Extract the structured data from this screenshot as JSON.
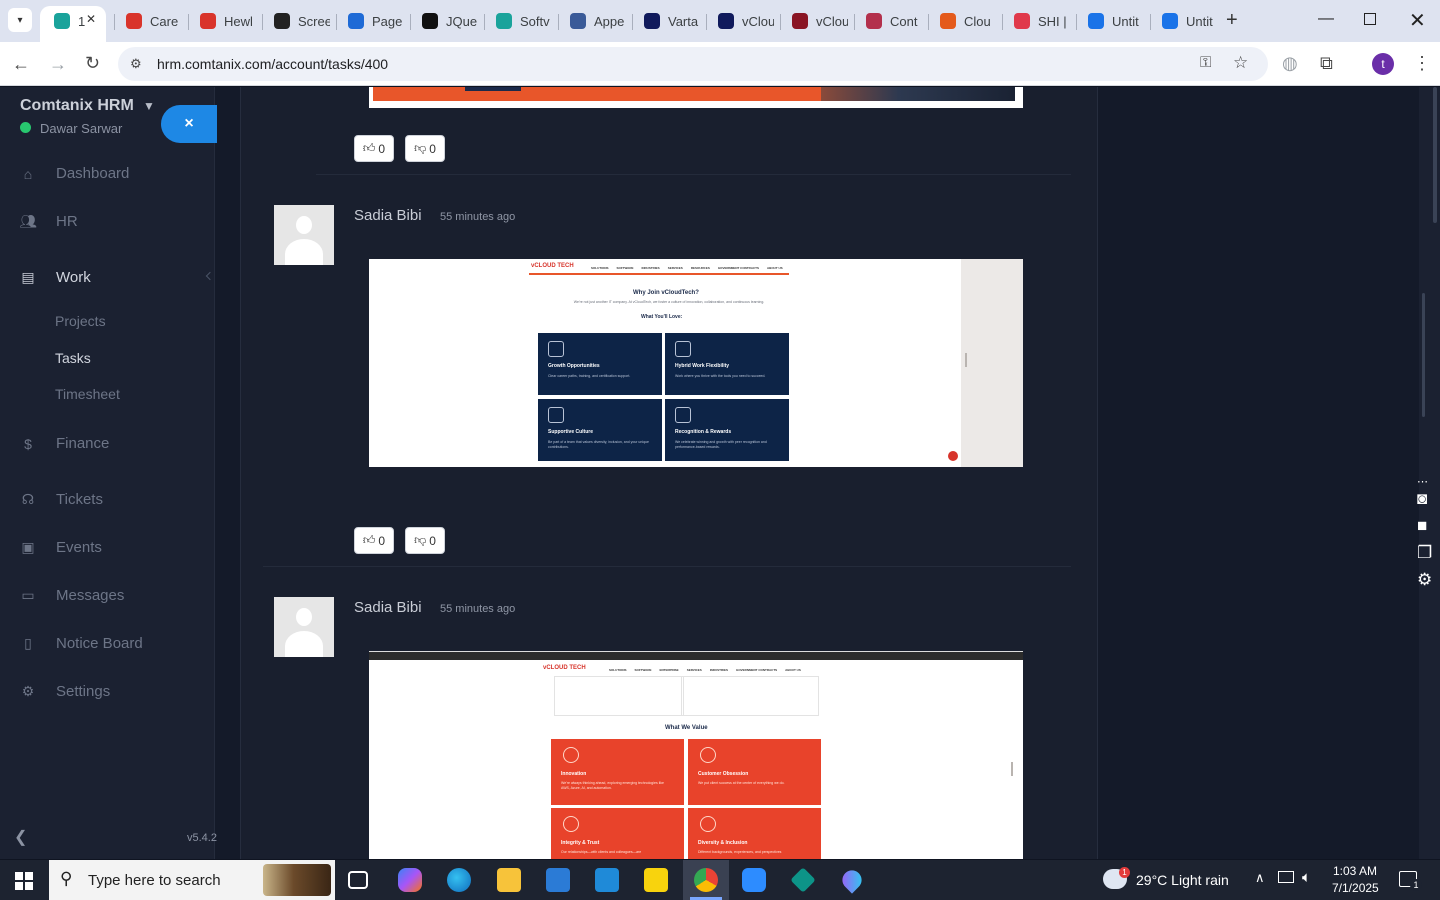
{
  "browser": {
    "tabs": [
      {
        "label": "1",
        "icon": "tab-favicon-icon",
        "color": "#1aa39b"
      },
      {
        "label": "Care",
        "icon": "tab-favicon-icon",
        "color": "#d9342b"
      },
      {
        "label": "Hewl",
        "icon": "tab-favicon-icon",
        "color": "#d9342b"
      },
      {
        "label": "Scree",
        "icon": "tab-favicon-icon",
        "color": "#222222"
      },
      {
        "label": "Page",
        "icon": "tab-favicon-icon",
        "color": "#1e6ad6"
      },
      {
        "label": "JQue",
        "icon": "tab-favicon-icon",
        "color": "#111111"
      },
      {
        "label": "Softv",
        "icon": "tab-favicon-icon",
        "color": "#1aa39b"
      },
      {
        "label": "Appe",
        "icon": "tab-favicon-icon",
        "color": "#3a5a98"
      },
      {
        "label": "Varta",
        "icon": "tab-favicon-icon",
        "color": "#101a5c"
      },
      {
        "label": "vClou",
        "icon": "tab-favicon-icon",
        "color": "#101a5c"
      },
      {
        "label": "vClou",
        "icon": "tab-favicon-icon",
        "color": "#8a1524"
      },
      {
        "label": "Cont",
        "icon": "tab-favicon-icon",
        "color": "#b3304c"
      },
      {
        "label": "Clou",
        "icon": "tab-favicon-icon",
        "color": "#e45a1b"
      },
      {
        "label": "SHI |",
        "icon": "tab-favicon-icon",
        "color": "#e0394b"
      },
      {
        "label": "Untit",
        "icon": "doc-icon",
        "color": "#1a73e8"
      },
      {
        "label": "Untit",
        "icon": "doc-icon",
        "color": "#1a73e8"
      }
    ],
    "url": "hrm.comtanix.com/account/tasks/400",
    "profile_initial": "t"
  },
  "sidebar": {
    "brand": "Comtanix HRM",
    "user": "Dawar Sarwar",
    "close_symbol": "×",
    "nav": [
      {
        "label": "Dashboard",
        "icon": "home-icon"
      },
      {
        "label": "HR",
        "icon": "users-icon"
      },
      {
        "label": "Work",
        "icon": "briefcase-icon"
      },
      {
        "label": "Finance",
        "icon": "dollar-icon"
      },
      {
        "label": "Tickets",
        "icon": "headset-icon"
      },
      {
        "label": "Events",
        "icon": "calendar-icon"
      },
      {
        "label": "Messages",
        "icon": "message-icon"
      },
      {
        "label": "Notice Board",
        "icon": "clipboard-icon"
      },
      {
        "label": "Settings",
        "icon": "gear-icon"
      }
    ],
    "work_sub": [
      {
        "label": "Projects"
      },
      {
        "label": "Tasks"
      },
      {
        "label": "Timesheet"
      }
    ],
    "version": "v5.4.2"
  },
  "comments": [
    {
      "likes": "0",
      "dislikes": "0"
    },
    {
      "author": "Sadia Bibi",
      "time": "55 minutes ago",
      "likes": "0",
      "dislikes": "0",
      "attachment": {
        "logo": "vCLOUD TECH",
        "heading": "Why Join vCloudTech?",
        "intro": "We're not just another IT company. At vCloudTech, we foster a culture of innovation, collaboration, and continuous learning.",
        "subheading": "What You'll Love:",
        "cards": [
          {
            "title": "Growth Opportunities",
            "desc": "Clear career paths, training, and certification support."
          },
          {
            "title": "Hybrid Work Flexibility",
            "desc": "Work where you thrive with the tools you need to succeed."
          },
          {
            "title": "Supportive Culture",
            "desc": "Be part of a team that values diversity, inclusion, and your unique contributions."
          },
          {
            "title": "Recognition & Rewards",
            "desc": "We celebrate winning and growth with peer recognition and performance-based rewards."
          }
        ]
      }
    },
    {
      "author": "Sadia Bibi",
      "time": "55 minutes ago",
      "attachment": {
        "logo": "vCLOUD TECH",
        "heading": "What We Value",
        "cards": [
          {
            "title": "Innovation",
            "desc": "We're always thinking ahead, exploring emerging technologies like AWS, Azure, AI, and automation."
          },
          {
            "title": "Customer Obsession",
            "desc": "We put client success at the center of everything we do."
          },
          {
            "title": "Integrity & Trust",
            "desc": "Our relationships—with clients and colleagues—are"
          },
          {
            "title": "Diversity & Inclusion",
            "desc": "Different backgrounds, experiences, and perspectives"
          }
        ]
      }
    }
  ],
  "taskbar": {
    "search_placeholder": "Type here to search",
    "weather": "29°C  Light rain",
    "weather_badge": "1",
    "time": "1:03 AM",
    "date": "7/1/2025",
    "notifications": "1"
  }
}
